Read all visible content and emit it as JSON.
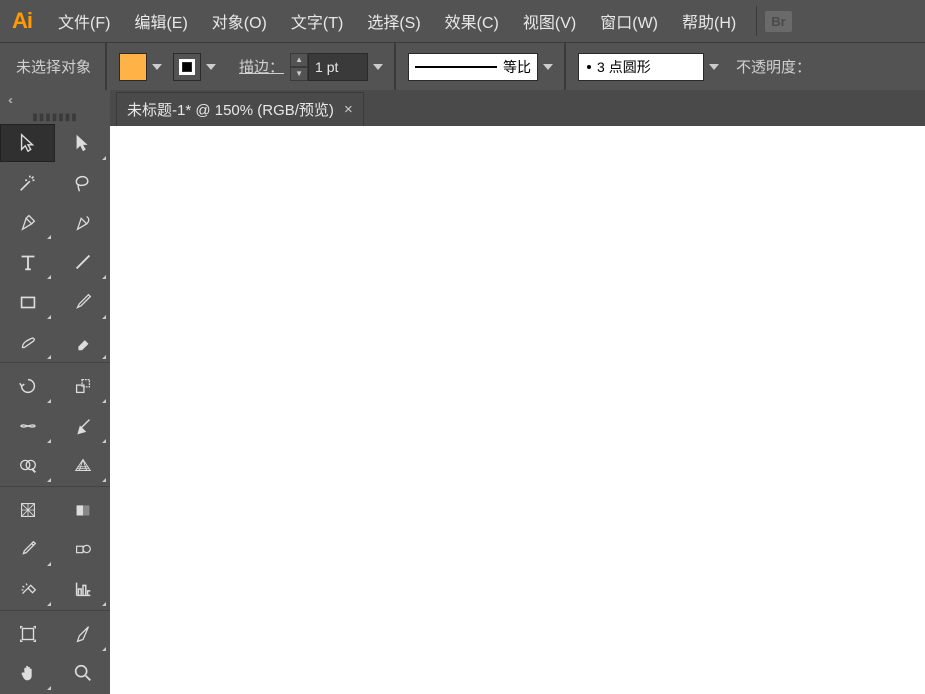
{
  "app_logo": "Ai",
  "menubar": {
    "items": [
      "文件(F)",
      "编辑(E)",
      "对象(O)",
      "文字(T)",
      "选择(S)",
      "效果(C)",
      "视图(V)",
      "窗口(W)",
      "帮助(H)"
    ],
    "bridge_badge": "Br"
  },
  "controlbar": {
    "selection_status": "未选择对象",
    "fill_color": "#ffb347",
    "stroke_color": "#000000",
    "stroke_label": "描边：",
    "stroke_value": "1 pt",
    "profile_label": "等比",
    "dash_label": "3 点圆形",
    "opacity_label": "不透明度："
  },
  "tab": {
    "title": "未标题-1* @ 150% (RGB/预览)"
  },
  "tools": {
    "rows": [
      [
        "selection-tool",
        "direct-selection-tool"
      ],
      [
        "magic-wand-tool",
        "lasso-tool"
      ],
      [
        "pen-tool",
        "curvature-tool"
      ],
      [
        "type-tool",
        "line-tool"
      ],
      [
        "rectangle-tool",
        "paintbrush-tool"
      ],
      [
        "shaper-tool",
        "eraser-tool"
      ],
      [
        "rotate-tool",
        "scale-tool"
      ],
      [
        "width-tool",
        "free-transform-tool"
      ],
      [
        "shape-builder-tool",
        "perspective-grid-tool"
      ],
      [
        "mesh-tool",
        "gradient-tool"
      ],
      [
        "eyedropper-tool",
        "blend-tool"
      ],
      [
        "symbol-sprayer-tool",
        "column-graph-tool"
      ],
      [
        "artboard-tool",
        "slice-tool"
      ],
      [
        "hand-tool",
        "zoom-tool"
      ]
    ]
  }
}
